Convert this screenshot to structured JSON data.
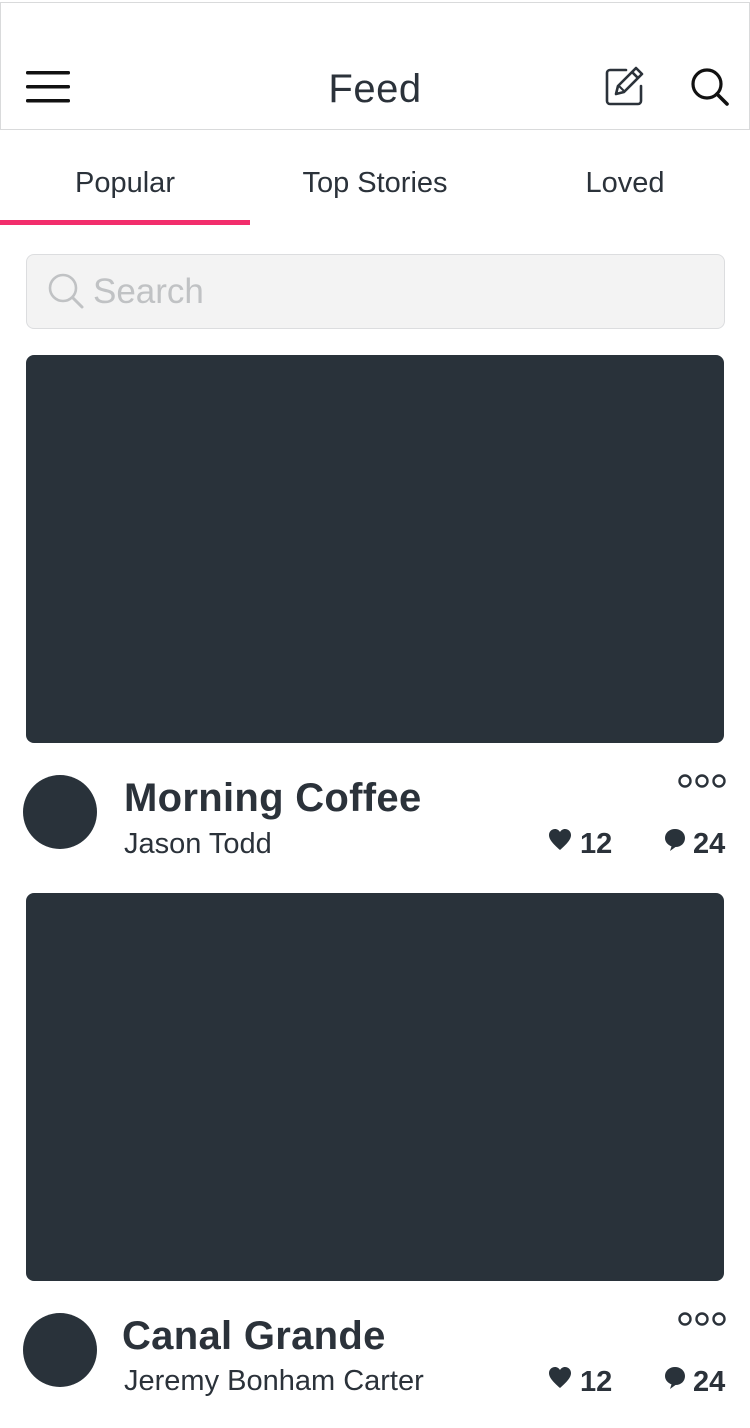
{
  "header": {
    "title": "Feed",
    "menu_icon": "hamburger-menu-icon",
    "edit_icon": "pencil-edit-icon",
    "search_icon": "search-icon"
  },
  "tabs": [
    {
      "label": "Popular",
      "active": true
    },
    {
      "label": "Top Stories",
      "active": false
    },
    {
      "label": "Loved",
      "active": false
    }
  ],
  "search": {
    "placeholder": "Search",
    "value": ""
  },
  "posts": [
    {
      "title": "Morning Coffee",
      "author": "Jason Todd",
      "likes": "12",
      "comments": "24"
    },
    {
      "title": "Canal Grande",
      "author": "Jeremy Bonham Carter",
      "likes": "12",
      "comments": "24"
    }
  ],
  "colors": {
    "accent": "#f22e6c",
    "dark": "#29323a",
    "text": "#2b323a",
    "search_bg": "#f3f3f3",
    "placeholder": "#c0c2c4"
  }
}
